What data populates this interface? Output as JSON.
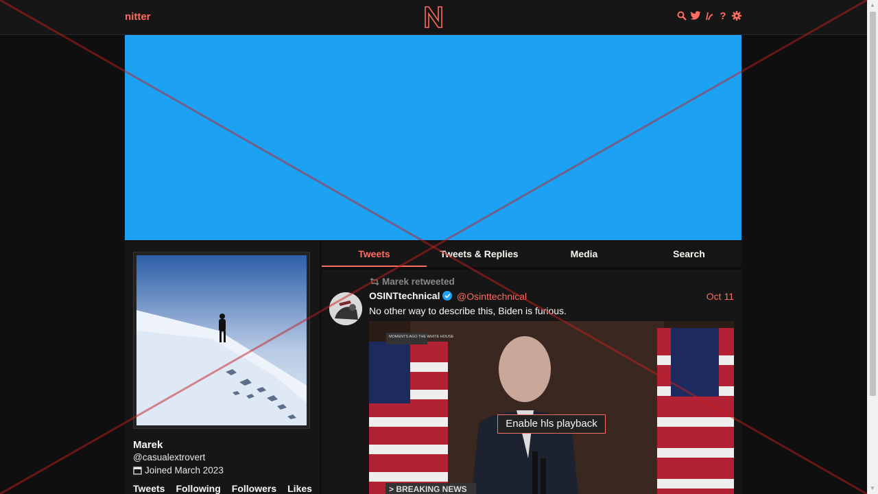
{
  "nav": {
    "brand": "nitter",
    "icons": [
      "search-icon",
      "twitter-bird-icon",
      "rss-icon",
      "help-icon",
      "gear-icon"
    ],
    "help_glyph": "?"
  },
  "profile": {
    "fullname": "Marek",
    "username": "@casualextrovert",
    "joined": "Joined March 2023",
    "stats": [
      "Tweets",
      "Following",
      "Followers",
      "Likes"
    ]
  },
  "tabs": [
    "Tweets",
    "Tweets & Replies",
    "Media",
    "Search"
  ],
  "tweet": {
    "retweet_header": "Marek retweeted",
    "fullname": "OSINTtechnical",
    "username": "@Osinttechnical",
    "date": "Oct 11",
    "text": "No other way to describe this, Biden is furious.",
    "media_button": "Enable hls playback",
    "media_badge": "MOMENTS AGO THE WHITE HOUSE",
    "media_ticker": "> BREAKING NEWS"
  },
  "colors": {
    "accent": "#ff6c60",
    "banner": "#1da1f2",
    "background": "#0f0f0f",
    "panel": "#161616"
  }
}
